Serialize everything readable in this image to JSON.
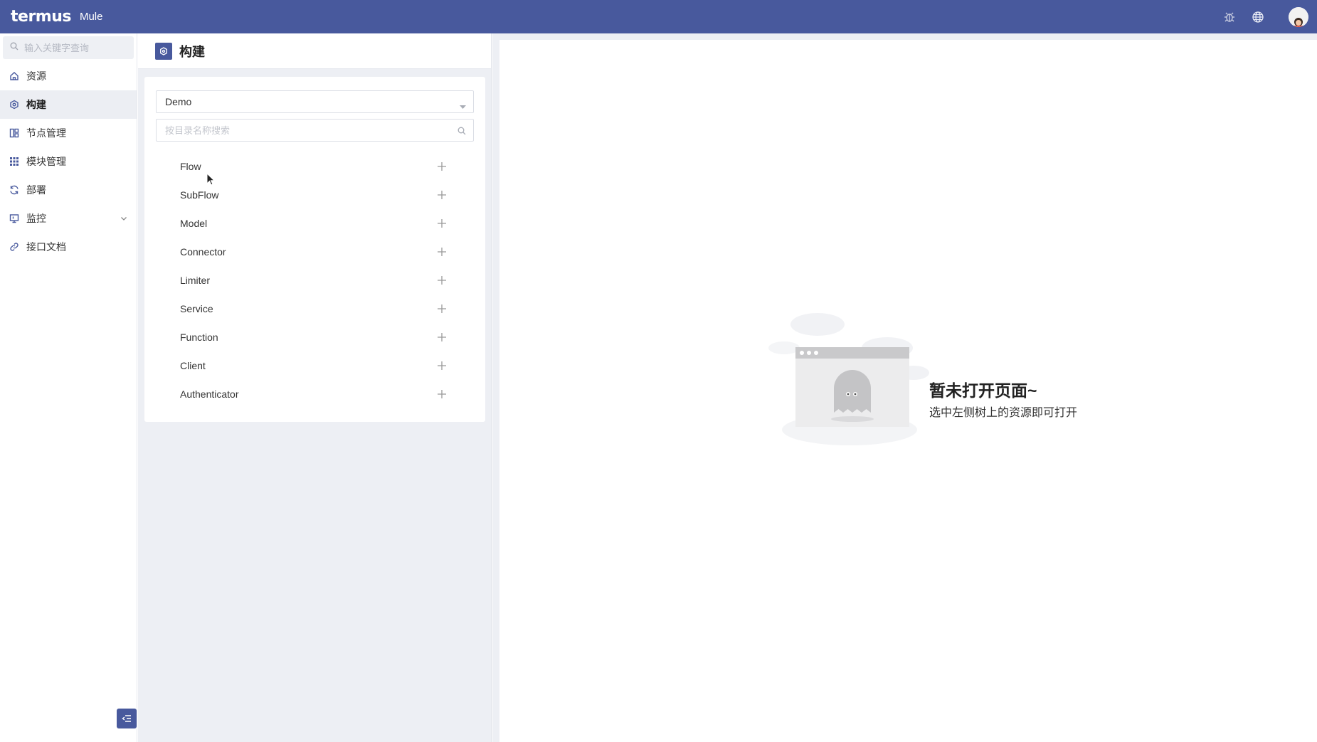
{
  "topbar": {
    "logo_text": "termus",
    "app_name": "Mule",
    "icons": [
      "bug-icon",
      "globe-icon",
      "user-avatar"
    ]
  },
  "sidebar": {
    "search_placeholder": "输入关键字查询",
    "items": [
      {
        "label": "资源",
        "icon": "home-icon",
        "active": false
      },
      {
        "label": "构建",
        "icon": "build-icon",
        "active": true
      },
      {
        "label": "节点管理",
        "icon": "layout-icon",
        "active": false
      },
      {
        "label": "模块管理",
        "icon": "grid-icon",
        "active": false
      },
      {
        "label": "部署",
        "icon": "refresh-icon",
        "active": false
      },
      {
        "label": "监控",
        "icon": "monitor-icon",
        "active": false,
        "expandable": true
      },
      {
        "label": "接口文档",
        "icon": "link-icon",
        "active": false
      }
    ]
  },
  "panel": {
    "title": "构建",
    "project_select": "Demo",
    "tree_search_placeholder": "按目录名称搜索",
    "tree_items": [
      "Flow",
      "SubFlow",
      "Model",
      "Connector",
      "Limiter",
      "Service",
      "Function",
      "Client",
      "Authenticator"
    ]
  },
  "empty_state": {
    "title": "暂未打开页面~",
    "subtitle": "选中左侧树上的资源即可打开"
  },
  "colors": {
    "brand": "#48599d",
    "panel_bg": "#edeff4",
    "active_nav_bg": "#eceef3"
  }
}
